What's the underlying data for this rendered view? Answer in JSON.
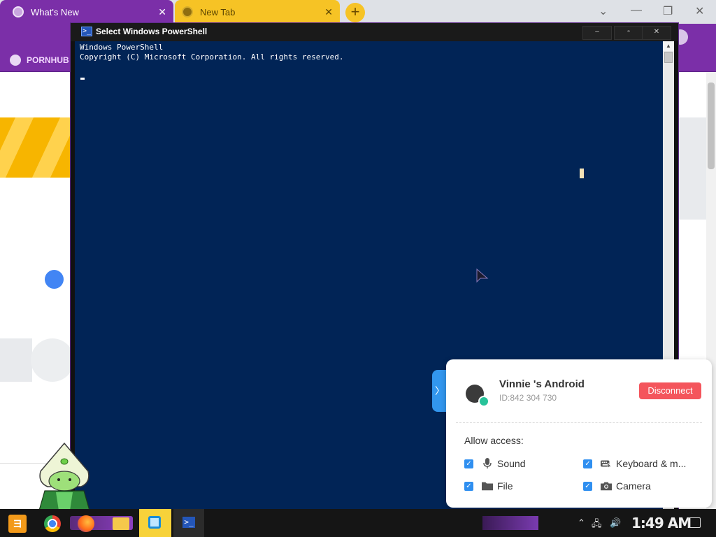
{
  "browser": {
    "tabs": [
      {
        "label": "What's New",
        "active": true
      },
      {
        "label": "New Tab",
        "active": false
      }
    ],
    "new_tab_label": "+",
    "tab_close_label": "✕",
    "window_controls": {
      "dropdown": "⌄",
      "minimize": "—",
      "restore": "❐",
      "close": "✕"
    },
    "bookmark": {
      "label": "PORNHUB"
    }
  },
  "powershell": {
    "title": "Select Windows PowerShell",
    "icon_glyph": ">_",
    "lines": [
      "Windows PowerShell",
      "Copyright (C) Microsoft Corporation. All rights reserved."
    ],
    "controls": {
      "minimize": "–",
      "maximize": "▫",
      "close": "✕"
    },
    "scroll_up": "▲"
  },
  "remote_panel": {
    "toggle_glyph": "〉",
    "device_name": "Vinnie 's Android",
    "device_id": "ID:842 304 730",
    "disconnect_label": "Disconnect",
    "allow_access_label": "Allow access:",
    "permissions": [
      {
        "label": "Sound",
        "icon": "microphone-icon",
        "checked": true
      },
      {
        "label": "Keyboard & m...",
        "icon": "keyboard-mouse-icon",
        "checked": true
      },
      {
        "label": "File",
        "icon": "folder-icon",
        "checked": true
      },
      {
        "label": "Camera",
        "icon": "camera-icon",
        "checked": true
      }
    ],
    "colors": {
      "accent": "#2f8ff0",
      "disconnect": "#f4555c"
    }
  },
  "taskbar": {
    "start_glyph": "ヨ",
    "clock": "1:49 AM",
    "tray": {
      "chevron": "⌃",
      "network": "🖧",
      "volume": "🔊"
    }
  },
  "colors": {
    "chrome_purple": "#7b2fa8",
    "tab_yellow": "#f6c325",
    "ps_background": "#012456"
  }
}
